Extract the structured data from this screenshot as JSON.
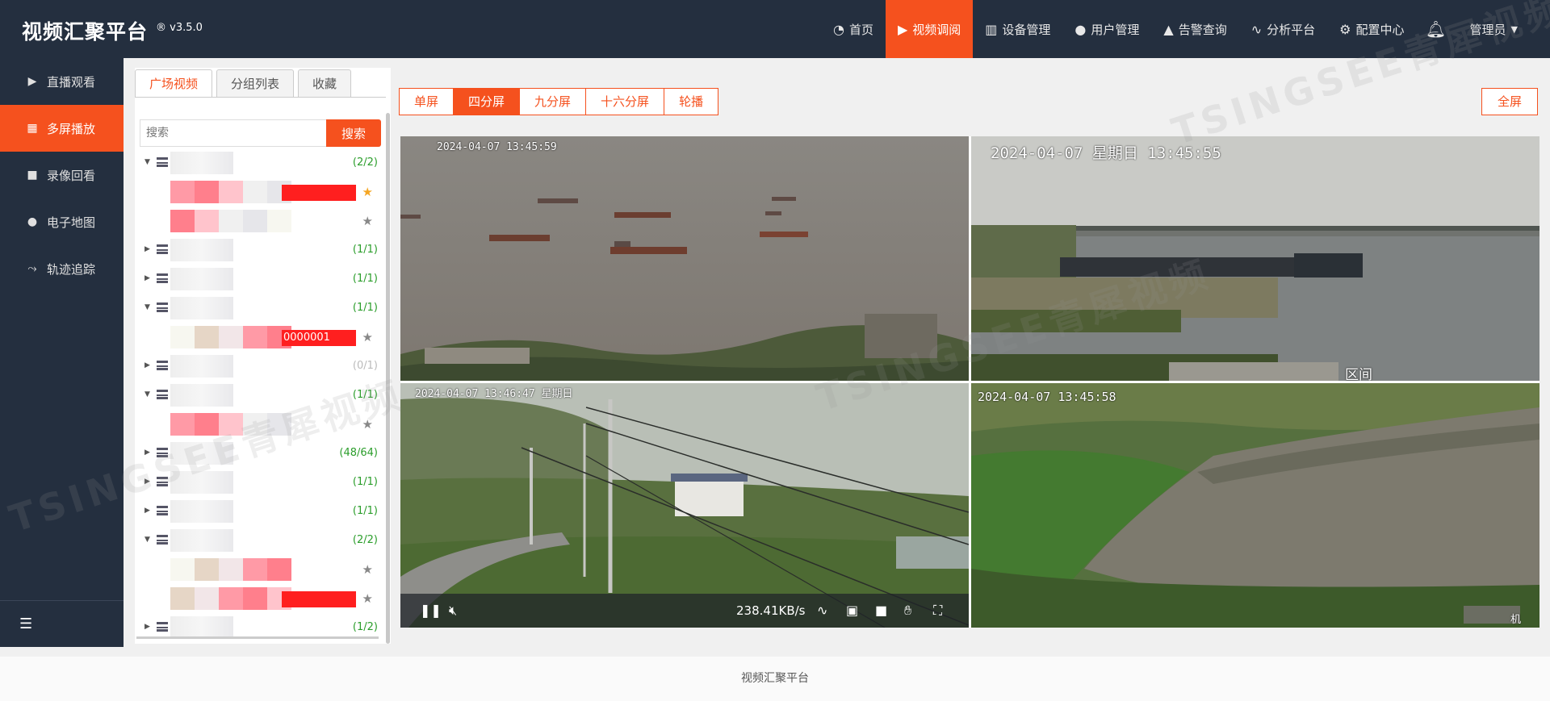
{
  "app": {
    "title": "视频汇聚平台",
    "version": "v3.5.0",
    "version_mark": "®"
  },
  "topnav": {
    "items": [
      {
        "label": "首页",
        "icon": "dashboard-icon"
      },
      {
        "label": "视频调阅",
        "icon": "play-circle-icon",
        "active": true
      },
      {
        "label": "设备管理",
        "icon": "device-icon"
      },
      {
        "label": "用户管理",
        "icon": "user-icon"
      },
      {
        "label": "告警查询",
        "icon": "alarm-icon"
      },
      {
        "label": "分析平台",
        "icon": "pulse-icon"
      },
      {
        "label": "配置中心",
        "icon": "gear-icon"
      }
    ],
    "user": "管理员"
  },
  "sidebar": {
    "items": [
      {
        "label": "直播观看",
        "icon": "play-circle-icon"
      },
      {
        "label": "多屏播放",
        "icon": "grid-icon",
        "active": true
      },
      {
        "label": "录像回看",
        "icon": "video-camera-icon"
      },
      {
        "label": "电子地图",
        "icon": "map-pin-icon"
      },
      {
        "label": "轨迹追踪",
        "icon": "track-icon"
      }
    ]
  },
  "tree_panel": {
    "tabs": [
      {
        "label": "广场视频",
        "active": true
      },
      {
        "label": "分组列表"
      },
      {
        "label": "收藏"
      }
    ],
    "search": {
      "placeholder": "搜索",
      "button": "搜索"
    },
    "rows": [
      {
        "kind": "group",
        "expanded": true,
        "count": "(2/2)"
      },
      {
        "kind": "channel",
        "label": "",
        "favorite": true
      },
      {
        "kind": "channel",
        "label": "",
        "favorite": false
      },
      {
        "kind": "group",
        "expanded": false,
        "count": "(1/1)"
      },
      {
        "kind": "group",
        "expanded": false,
        "count": "(1/1)"
      },
      {
        "kind": "group",
        "expanded": true,
        "count": "(1/1)"
      },
      {
        "kind": "channel",
        "label": "0000001",
        "favorite": false
      },
      {
        "kind": "group",
        "expanded": false,
        "count": "(0/1)",
        "offline": true
      },
      {
        "kind": "group",
        "expanded": true,
        "count": "(1/1)"
      },
      {
        "kind": "channel",
        "label": "",
        "favorite": false
      },
      {
        "kind": "group",
        "expanded": false,
        "count": "(48/64)"
      },
      {
        "kind": "group",
        "expanded": false,
        "count": "(1/1)"
      },
      {
        "kind": "group",
        "expanded": false,
        "count": "(1/1)"
      },
      {
        "kind": "group",
        "expanded": true,
        "count": "(2/2)"
      },
      {
        "kind": "channel",
        "label": "",
        "favorite": false
      },
      {
        "kind": "channel",
        "label": "",
        "favorite": false
      },
      {
        "kind": "group",
        "expanded": false,
        "count": "(1/2)"
      }
    ]
  },
  "split_modes": {
    "buttons": [
      {
        "label": "单屏"
      },
      {
        "label": "四分屏",
        "active": true
      },
      {
        "label": "九分屏"
      },
      {
        "label": "十六分屏"
      },
      {
        "label": "轮播"
      }
    ],
    "fullscreen": "全屏"
  },
  "videos": [
    {
      "timestamp": "2024-04-07 13:45:59",
      "scene": "river-boats"
    },
    {
      "timestamp": "2024-04-07 星期日 13:45:55",
      "scene": "bridge-barge",
      "caption": "区间"
    },
    {
      "timestamp": "2024-04-07 13:46:47 星期日",
      "scene": "village-powerlines",
      "speed": "238.41KB/s"
    },
    {
      "timestamp": "2024-04-07 13:45:58",
      "scene": "riverbank-trees",
      "caption": "机"
    }
  ],
  "footer": "视频汇聚平台",
  "watermark": "TSINGSEE青犀视频",
  "colors": {
    "accent": "#f5511e",
    "nav_bg": "#242f3f",
    "online": "#2a9d2a",
    "favorite": "#f5a623"
  }
}
